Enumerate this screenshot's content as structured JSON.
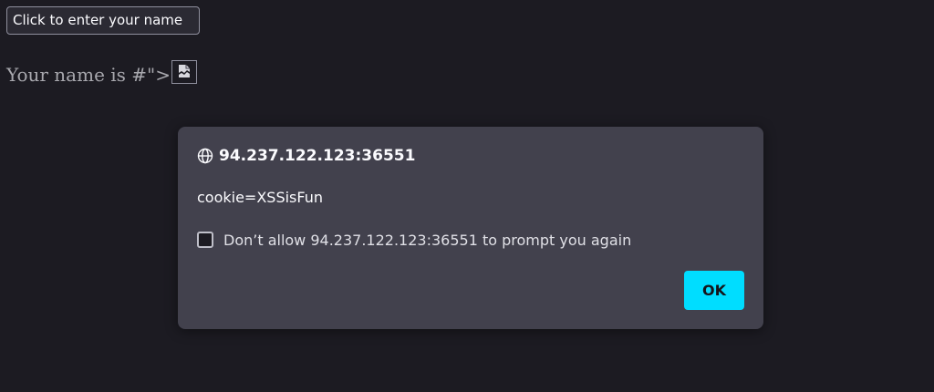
{
  "page": {
    "name_button_label": "Click to enter your name",
    "name_text": "Your name is #\">",
    "broken_image_icon": "broken-image-icon"
  },
  "dialog": {
    "origin": "94.237.122.123:36551",
    "origin_icon": "globe-icon",
    "message": "cookie=XSSisFun",
    "checkbox_label": "Don’t allow 94.237.122.123:36551 to prompt you again",
    "checkbox_checked": false,
    "ok_label": "OK"
  },
  "colors": {
    "background": "#1c1b22",
    "dialog_background": "#42414d",
    "accent": "#00ddff"
  }
}
